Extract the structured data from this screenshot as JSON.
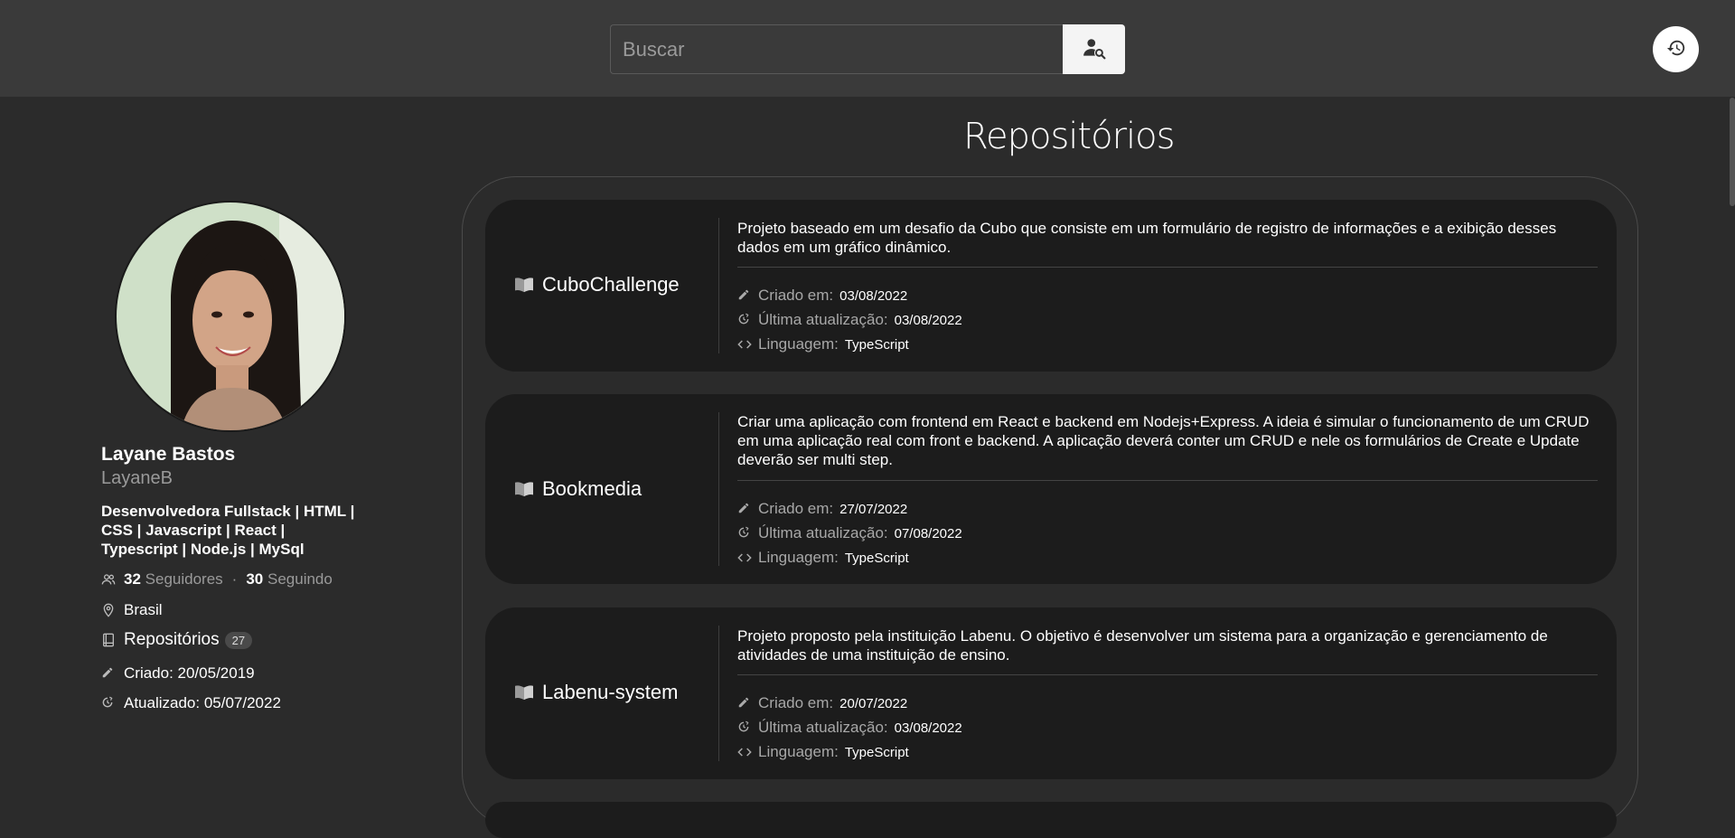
{
  "search": {
    "placeholder": "Buscar",
    "button_icon": "user-search-icon"
  },
  "history_button_icon": "history-icon",
  "profile": {
    "name": "Layane Bastos",
    "login": "LayaneB",
    "bio": "Desenvolvedora Fullstack | HTML | CSS | Javascript | React | Typescript | Node.js | MySql",
    "followers_count": "32",
    "followers_label": "Seguidores",
    "following_count": "30",
    "following_label": "Seguindo",
    "location": "Brasil",
    "repositories_label": "Repositórios",
    "repositories_count": "27",
    "created": "Criado: 20/05/2019",
    "updated": "Atualizado: 05/07/2022"
  },
  "repositories_title": "Repositórios",
  "labels": {
    "created": "Criado em:",
    "updated": "Última atualização:",
    "language": "Linguagem:"
  },
  "repos": [
    {
      "name": "CuboChallenge",
      "description": "Projeto baseado em um desafio da Cubo que consiste em um formulário de registro de informações e a exibição desses dados em um gráfico dinâmico.",
      "created": "03/08/2022",
      "updated": "03/08/2022",
      "language": "TypeScript"
    },
    {
      "name": "Bookmedia",
      "description": "Criar uma aplicação com frontend em React e backend em Nodejs+Express. A ideia é simular o funcionamento de um CRUD em uma aplicação real com front e backend. A aplicação deverá conter um CRUD e nele os formulários de Create e Update deverão ser multi step.",
      "created": "27/07/2022",
      "updated": "07/08/2022",
      "language": "TypeScript"
    },
    {
      "name": "Labenu-system",
      "description": "Projeto proposto pela instituição Labenu. O objetivo é desenvolver um sistema para a organização e gerenciamento de atividades de uma instituição de ensino.",
      "created": "20/07/2022",
      "updated": "03/08/2022",
      "language": "TypeScript"
    }
  ]
}
